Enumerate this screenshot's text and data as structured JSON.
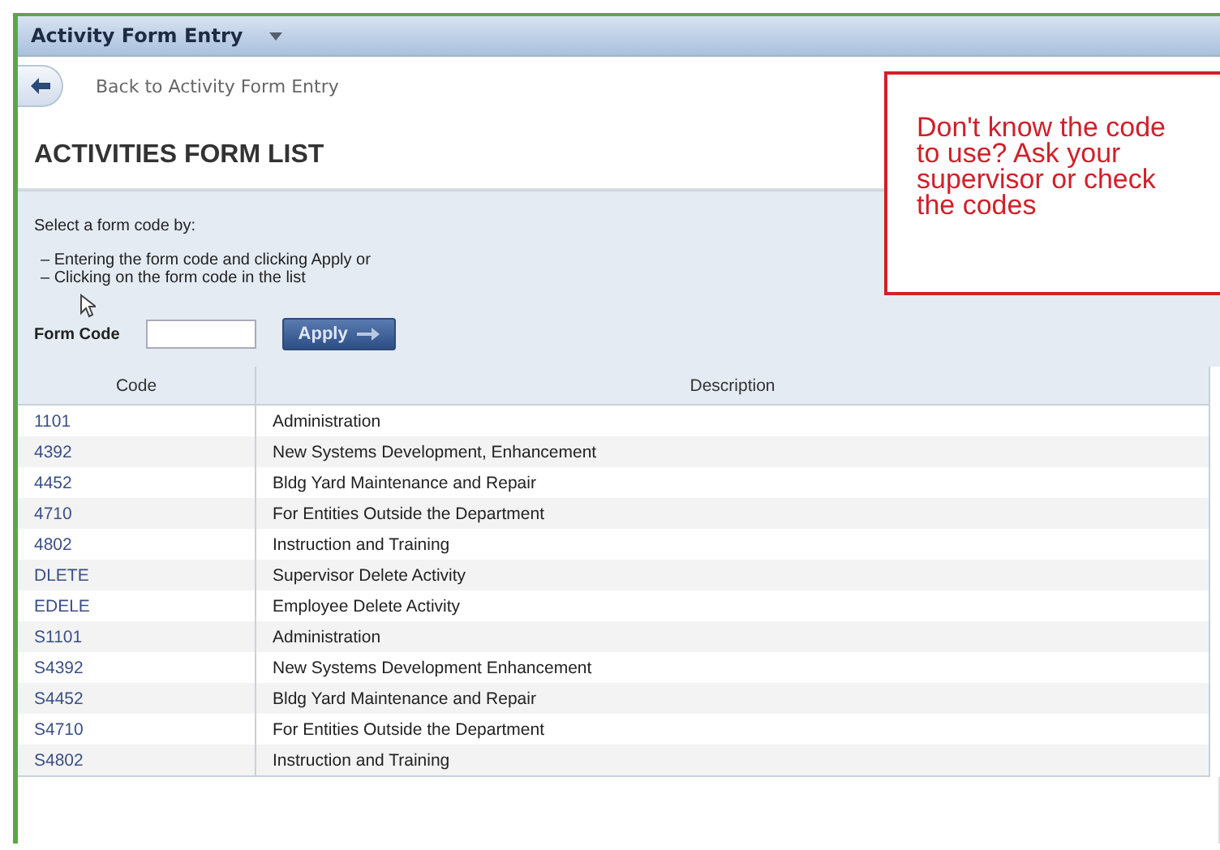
{
  "window": {
    "title": "Activity Form Entry"
  },
  "back_link": {
    "label": "Back to Activity Form Entry"
  },
  "heading": "ACTIVITIES FORM LIST",
  "instructions": {
    "intro": "Select a form code by:",
    "options": [
      "– Entering the form code and clicking Apply or",
      "– Clicking on the form code in the list"
    ]
  },
  "form_code": {
    "label": "Form Code",
    "button": "Apply"
  },
  "table": {
    "columns": [
      "Code",
      "Description"
    ],
    "rows": [
      {
        "code": "1101",
        "description": "Administration"
      },
      {
        "code": "4392",
        "description": "New Systems Development, Enhancement"
      },
      {
        "code": "4452",
        "description": "Bldg Yard Maintenance and Repair"
      },
      {
        "code": "4710",
        "description": "For Entities Outside the Department"
      },
      {
        "code": "4802",
        "description": "Instruction and Training"
      },
      {
        "code": "DLETE",
        "description": "Supervisor Delete Activity"
      },
      {
        "code": "EDELE",
        "description": "Employee Delete Activity"
      },
      {
        "code": "S1101",
        "description": "Administration"
      },
      {
        "code": "S4392",
        "description": "New Systems Development Enhancement"
      },
      {
        "code": "S4452",
        "description": "Bldg Yard Maintenance and Repair"
      },
      {
        "code": "S4710",
        "description": "For Entities Outside the Department"
      },
      {
        "code": "S4802",
        "description": "Instruction and Training"
      }
    ]
  },
  "callout": "Don't know the code to use? Ask your supervisor or check the codes"
}
